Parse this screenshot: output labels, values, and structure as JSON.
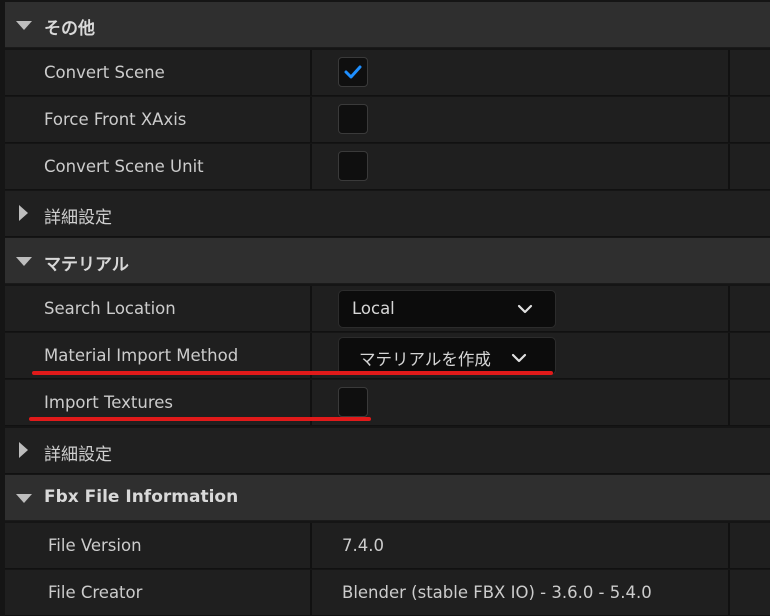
{
  "sections": {
    "other": {
      "title": "その他"
    },
    "material": {
      "title": "マテリアル"
    },
    "fbx": {
      "title": "Fbx File Information"
    }
  },
  "other_props": {
    "convert_scene": {
      "label": "Convert Scene",
      "checked": true
    },
    "force_front_xaxis": {
      "label": "Force Front XAxis",
      "checked": false
    },
    "convert_scene_unit": {
      "label": "Convert Scene Unit",
      "checked": false
    },
    "advanced": {
      "label": "詳細設定"
    }
  },
  "material_props": {
    "search_location": {
      "label": "Search Location",
      "value": "Local"
    },
    "material_import_method": {
      "label": "Material Import Method",
      "value": "マテリアルを作成"
    },
    "import_textures": {
      "label": "Import Textures",
      "checked": false
    },
    "advanced": {
      "label": "詳細設定"
    }
  },
  "fbx_props": {
    "file_version": {
      "label": "File Version",
      "value": "7.4.0"
    },
    "file_creator": {
      "label": "File Creator",
      "value": "Blender (stable FBX IO) - 3.6.0 - 5.4.0"
    }
  },
  "colors": {
    "checkmark": "#1e8fff",
    "annotation_underline": "#e01a1a"
  },
  "icons": {
    "section_expanded": "triangle-down-icon",
    "group_collapsed": "triangle-right-icon",
    "dropdown": "chevron-down-icon",
    "check": "checkmark-icon"
  }
}
